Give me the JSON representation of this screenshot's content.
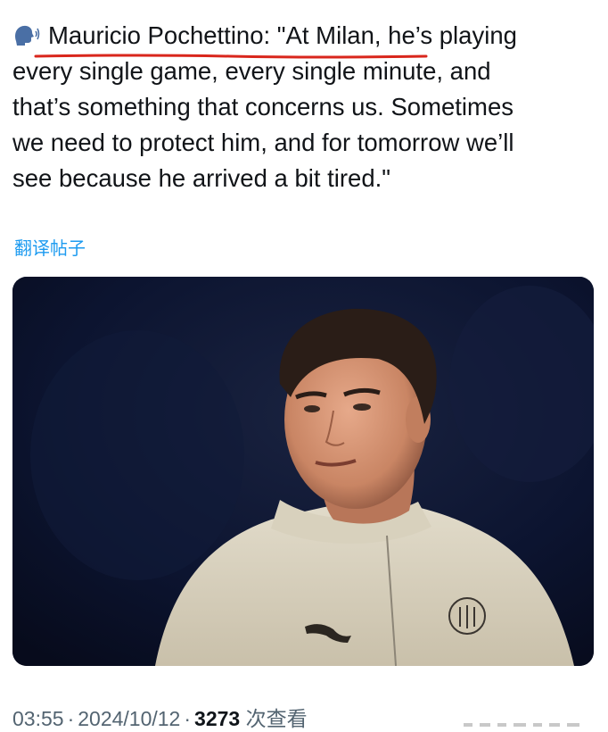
{
  "tweet": {
    "lines": [
      "Mauricio Pochettino: \"At Milan, he’s playing",
      "every single game, every single minute, and",
      "that’s something that concerns us. Sometimes",
      "we need to protect him, and for tomorrow we’ll",
      "see because he arrived a bit tired.\""
    ],
    "icon": "speaking-head-icon"
  },
  "translate_label": "翻译帖子",
  "media": {
    "description_icon": "player-photo"
  },
  "meta": {
    "time": "03:55",
    "separator": "·",
    "date": "2024/10/12",
    "views": "3273",
    "views_label": "次查看"
  },
  "colors": {
    "link": "#1d9bf0",
    "underline": "#d9261c",
    "meta": "#536471",
    "text": "#111418"
  }
}
